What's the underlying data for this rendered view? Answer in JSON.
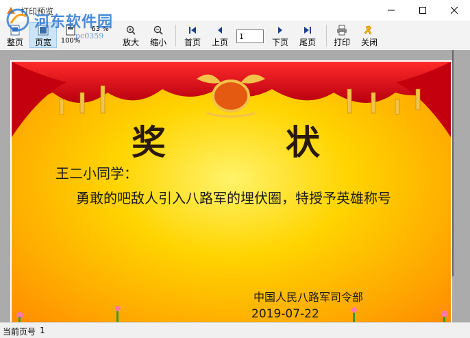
{
  "window": {
    "title": "打印预览",
    "minimize_label": "—",
    "maximize_label": "□",
    "close_label": "✕"
  },
  "watermark": {
    "brand": "河东软件园",
    "url": "pc0359"
  },
  "toolbar": {
    "single_page": "整页",
    "page_width": "页宽",
    "zoom_100": "100%",
    "zoom_percent": "63 %",
    "zoom_in": "放大",
    "zoom_out": "缩小",
    "first_page": "首页",
    "prev_page": "上页",
    "page_number": "1",
    "next_page": "下页",
    "last_page": "尾页",
    "print": "打印",
    "close": "关闭"
  },
  "certificate": {
    "title_char1": "奖",
    "title_char2": "状",
    "greeting": "王二小同学：",
    "body": "勇敢的吧敌人引入八路军的埋伏圈，特授予英雄称号",
    "issuer": "中国人民八路军司令部",
    "date": "2019-07-22"
  },
  "status": {
    "label": "当前页号",
    "value": "1"
  },
  "colors": {
    "curtain_red": "#d4101c",
    "background_gold": "#ffd400",
    "toolbar_active": "#cde4f7"
  }
}
